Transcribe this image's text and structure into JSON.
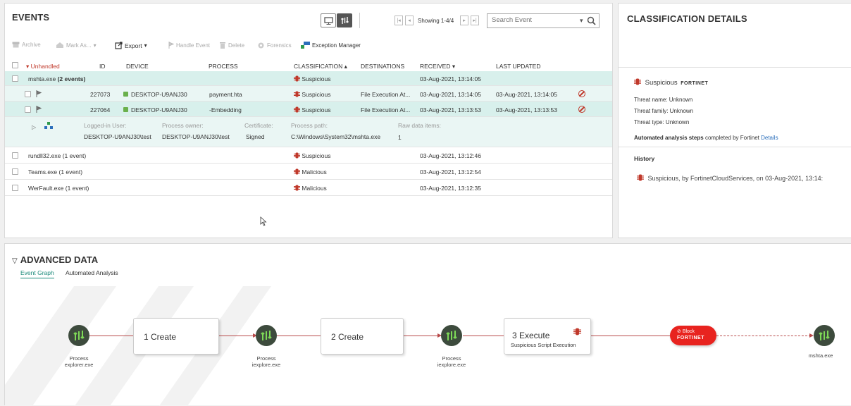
{
  "events": {
    "title": "EVENTS",
    "search_placeholder": "Search Event",
    "showing": "Showing 1-4/4",
    "toolbar": {
      "archive": "Archive",
      "mark_as": "Mark As...",
      "export": "Export",
      "handle_event": "Handle Event",
      "delete": "Delete",
      "forensics": "Forensics",
      "exception_manager": "Exception Manager"
    },
    "columns": {
      "filter": "Unhandled",
      "id": "ID",
      "device": "DEVICE",
      "process": "PROCESS",
      "classification": "CLASSIFICATION",
      "destinations": "DESTINATIONS",
      "received": "RECEIVED",
      "last_updated": "LAST UPDATED"
    },
    "group": {
      "name": "mshta.exe",
      "count": "(2 events)",
      "classification": "Suspicious",
      "received": "03-Aug-2021, 13:14:05"
    },
    "rows": [
      {
        "id": "227073",
        "device": "DESKTOP-U9ANJ30",
        "process": "payment.hta",
        "classification": "Suspicious",
        "destinations": "File Execution At...",
        "received": "03-Aug-2021, 13:14:05",
        "last_updated": "03-Aug-2021, 13:14:05"
      },
      {
        "id": "227064",
        "device": "DESKTOP-U9ANJ30",
        "process": "-Embedding",
        "classification": "Suspicious",
        "destinations": "File Execution At...",
        "received": "03-Aug-2021, 13:13:53",
        "last_updated": "03-Aug-2021, 13:13:53"
      }
    ],
    "detail": {
      "logged_in_label": "Logged-in User:",
      "logged_in_value": "DESKTOP-U9ANJ30\\test",
      "owner_label": "Process owner:",
      "owner_value": "DESKTOP-U9ANJ30\\test",
      "cert_label": "Certificate:",
      "cert_value": "Signed",
      "path_label": "Process path:",
      "path_value": "C:\\Windows\\System32\\mshta.exe",
      "raw_label": "Raw data items:",
      "raw_value": "1"
    },
    "other_groups": [
      {
        "name": "rundll32.exe",
        "count": "(1 event)",
        "classification": "Suspicious",
        "received": "03-Aug-2021, 13:12:46"
      },
      {
        "name": "Teams.exe",
        "count": "(1 event)",
        "classification": "Malicious",
        "received": "03-Aug-2021, 13:12:54"
      },
      {
        "name": "WerFault.exe",
        "count": "(1 event)",
        "classification": "Malicious",
        "received": "03-Aug-2021, 13:12:35"
      }
    ]
  },
  "classification": {
    "title": "CLASSIFICATION DETAILS",
    "verdict": "Suspicious",
    "vendor": "FORTINET",
    "threat_name": "Threat name: Unknown",
    "threat_family": "Threat family: Unknown",
    "threat_type": "Threat type: Unknown",
    "analysis_bold": "Automated analysis steps",
    "analysis_rest": "completed by Fortinet",
    "analysis_link": "Details",
    "history_title": "History",
    "history_item": "Suspicious, by FortinetCloudServices, on 03-Aug-2021, 13:14:"
  },
  "advanced": {
    "title": "ADVANCED DATA",
    "tab_graph": "Event Graph",
    "tab_analysis": "Automated Analysis",
    "nodes": [
      {
        "label1": "Process",
        "label2": "explorer.exe"
      },
      {
        "label1": "Process",
        "label2": "iexplore.exe"
      },
      {
        "label1": "Process",
        "label2": "iexplore.exe"
      },
      {
        "label1": "",
        "label2": "mshta.exe"
      }
    ],
    "steps": {
      "create1": "1 Create",
      "create2": "2 Create",
      "execute": "3 Execute",
      "execute_sub": "Suspicious Script Execution"
    },
    "block_label": "Block",
    "block_vendor": "FORTINET"
  },
  "colors": {
    "teal_row": "#d8f0ec",
    "danger": "#c0392b",
    "link": "#2a6ebb",
    "block_red": "#e8231f"
  }
}
